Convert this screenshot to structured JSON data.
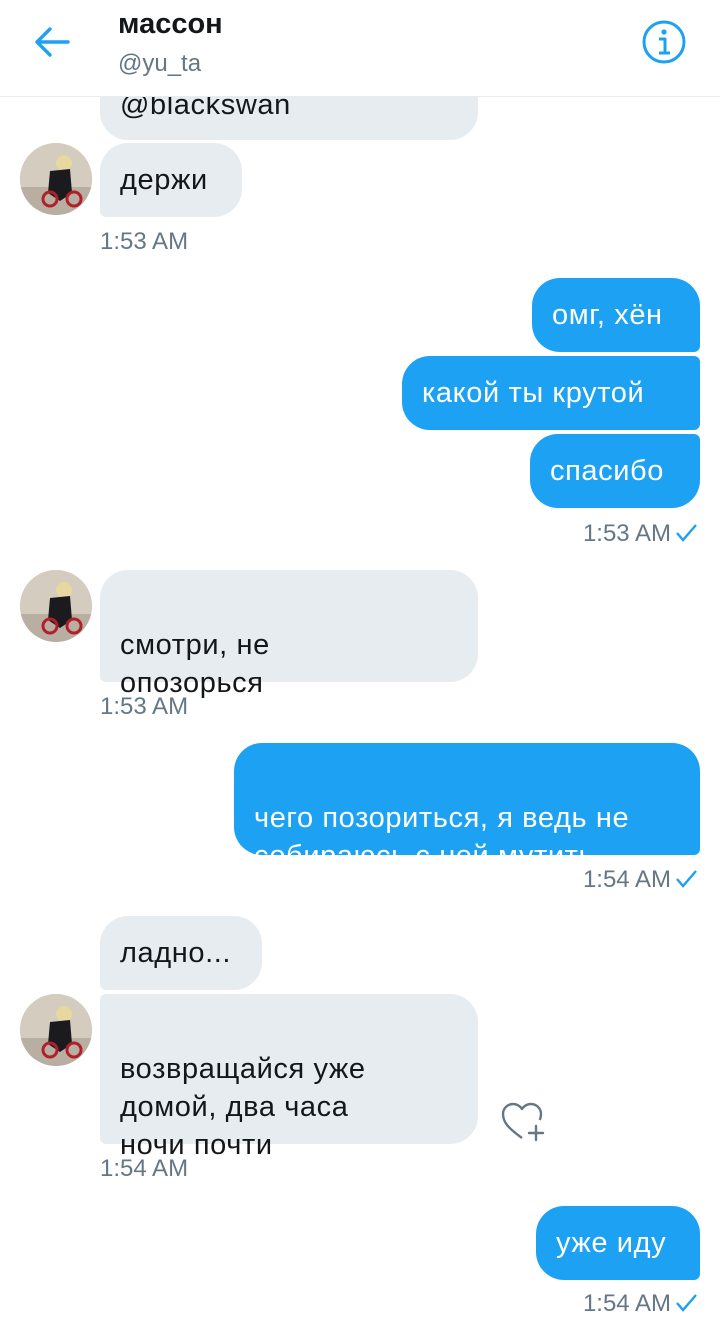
{
  "header": {
    "title": "массон",
    "handle": "@yu_ta"
  },
  "messages": [
    {
      "text": "@blackswan",
      "side": "in"
    },
    {
      "text": "держи",
      "side": "in"
    },
    {
      "time": "1:53 AM"
    },
    {
      "text": "омг, хён",
      "side": "out"
    },
    {
      "text": "какой ты крутой",
      "side": "out"
    },
    {
      "text": "спасибо",
      "side": "out"
    },
    {
      "time": "1:53 AM"
    },
    {
      "text": "смотри, не\nопозорься",
      "side": "in"
    },
    {
      "time": "1:53 AM"
    },
    {
      "text": "чего позориться, я ведь не\nсобираюсь с ней мутить",
      "side": "out"
    },
    {
      "time": "1:54 AM"
    },
    {
      "text": "ладно...",
      "side": "in"
    },
    {
      "text": "возвращайся уже\nдомой, два часа\nночи почти",
      "side": "in"
    },
    {
      "time": "1:54 AM"
    },
    {
      "text": "уже иду",
      "side": "out"
    },
    {
      "time": "1:54 AM"
    }
  ],
  "colors": {
    "accent": "#1da1f2",
    "incoming_bubble": "#e6ecf0",
    "meta_text": "#657786"
  },
  "icons": [
    "back-arrow-icon",
    "info-icon",
    "read-check-icon",
    "like-heart-plus-icon"
  ]
}
